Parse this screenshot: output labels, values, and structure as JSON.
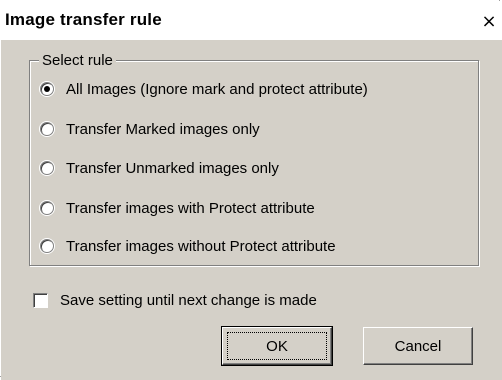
{
  "dialog": {
    "title": "Image transfer rule",
    "close_glyph": "×"
  },
  "group": {
    "legend": "Select rule",
    "options": [
      {
        "label": "All Images (Ignore mark and protect attribute)",
        "checked": true
      },
      {
        "label": "Transfer Marked images only",
        "checked": false
      },
      {
        "label": "Transfer Unmarked images only",
        "checked": false
      },
      {
        "label": "Transfer images with Protect attribute",
        "checked": false
      },
      {
        "label": "Transfer images without Protect attribute",
        "checked": false
      }
    ]
  },
  "save_setting": {
    "label": "Save setting until next change is made",
    "checked": false
  },
  "buttons": {
    "ok_label": "OK",
    "cancel_label": "Cancel"
  }
}
